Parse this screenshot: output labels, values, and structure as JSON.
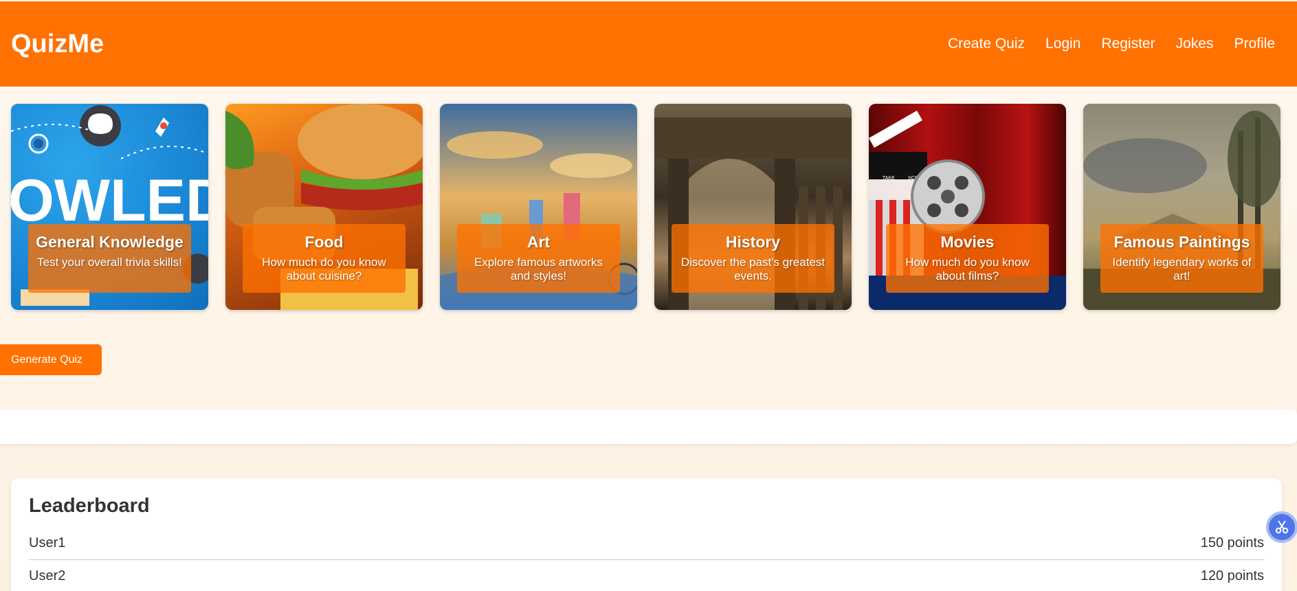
{
  "app": {
    "title": "QuizMe"
  },
  "nav": {
    "items": [
      {
        "label": "Create Quiz"
      },
      {
        "label": "Login"
      },
      {
        "label": "Register"
      },
      {
        "label": "Jokes"
      },
      {
        "label": "Profile"
      }
    ]
  },
  "categories": [
    {
      "title": "General Knowledge",
      "description": "Test your overall trivia skills!",
      "image_word": "OWLED"
    },
    {
      "title": "Food",
      "description": "How much do you know about cuisine?"
    },
    {
      "title": "Art",
      "description": "Explore famous artworks and styles!"
    },
    {
      "title": "History",
      "description": "Discover the past's greatest events."
    },
    {
      "title": "Movies",
      "description": "How much do you know about films?",
      "image_labels": [
        "TAKE",
        "SCE"
      ]
    },
    {
      "title": "Famous Paintings",
      "description": "Identify legendary works of art!"
    }
  ],
  "actions": {
    "generate_label": "Generate Quiz"
  },
  "leaderboard": {
    "title": "Leaderboard",
    "rows": [
      {
        "name": "User1",
        "score": "150 points"
      },
      {
        "name": "User2",
        "score": "120 points"
      }
    ]
  },
  "colors": {
    "brand": "#ff7100",
    "background": "#fff8ef",
    "float_button": "#4f76e8"
  },
  "icons": {
    "float_button": "scissors-icon"
  }
}
